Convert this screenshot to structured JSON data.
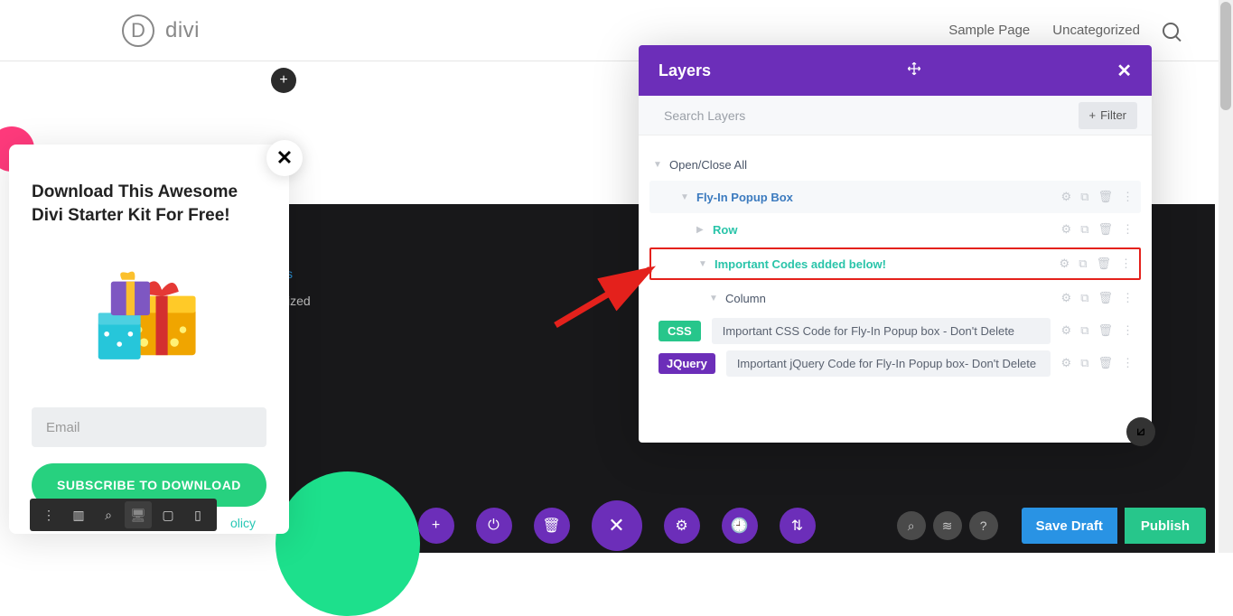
{
  "header": {
    "logo_text": "divi",
    "logo_letter": "D",
    "nav": {
      "sample": "Sample Page",
      "uncat": "Uncategorized"
    }
  },
  "starter": {
    "title": "Download This Awesome Divi Starter Kit For Free!",
    "email_placeholder": "Email",
    "subscribe": "SUBSCRIBE TO DOWNLOAD",
    "policy": "olicy"
  },
  "canvas": {
    "link1": "s",
    "text2": "ized"
  },
  "layers": {
    "title": "Layers",
    "search_placeholder": "Search Layers",
    "filter": "Filter",
    "open_close": "Open/Close All",
    "items": {
      "flyin": "Fly-In Popup Box",
      "row": "Row",
      "important": "Important Codes added below!",
      "column": "Column",
      "css_badge": "CSS",
      "css_text": "Important CSS Code for Fly-In Popup box - Don't Delete",
      "jq_badge": "JQuery",
      "jq_text": "Important jQuery Code for Fly-In Popup box- Don't Delete"
    }
  },
  "bottom": {
    "save": "Save Draft",
    "publish": "Publish"
  }
}
